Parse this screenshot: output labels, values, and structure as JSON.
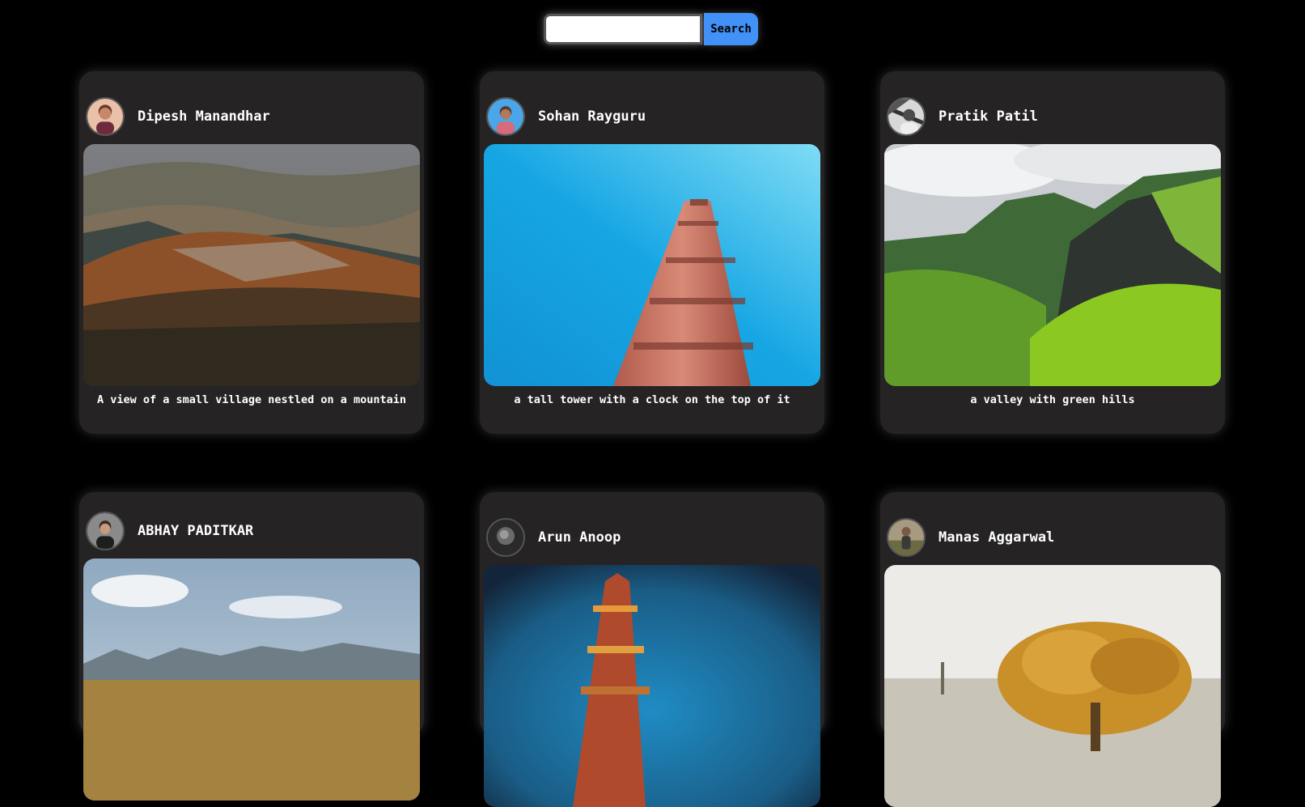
{
  "search": {
    "placeholder": "",
    "value": "",
    "button_label": "Search"
  },
  "posts": [
    {
      "author": "Dipesh Manandhar",
      "caption": "A view of a small village nestled on a mountain",
      "avatar_icon": "user-avatar-photo",
      "photo": "mountain-village-landscape"
    },
    {
      "author": "Sohan Rayguru",
      "caption": "a tall tower with a clock on the top of it",
      "avatar_icon": "user-avatar-photo",
      "photo": "brick-tower-blue-sky"
    },
    {
      "author": "Pratik Patil",
      "caption": "a valley with green hills",
      "avatar_icon": "user-avatar-photo",
      "photo": "green-valley-cliffs"
    },
    {
      "author": "ABHAY PADITKAR",
      "caption": "",
      "avatar_icon": "user-avatar-photo",
      "photo": "mountain-plain-sky"
    },
    {
      "author": "Arun Anoop",
      "caption": "",
      "avatar_icon": "user-avatar-photo",
      "photo": "tower-blurred-blue"
    },
    {
      "author": "Manas Aggarwal",
      "caption": "",
      "avatar_icon": "user-avatar-photo",
      "photo": "autumn-tree"
    }
  ],
  "colors": {
    "background": "#000000",
    "card": "#252323",
    "accent": "#4191f6"
  }
}
